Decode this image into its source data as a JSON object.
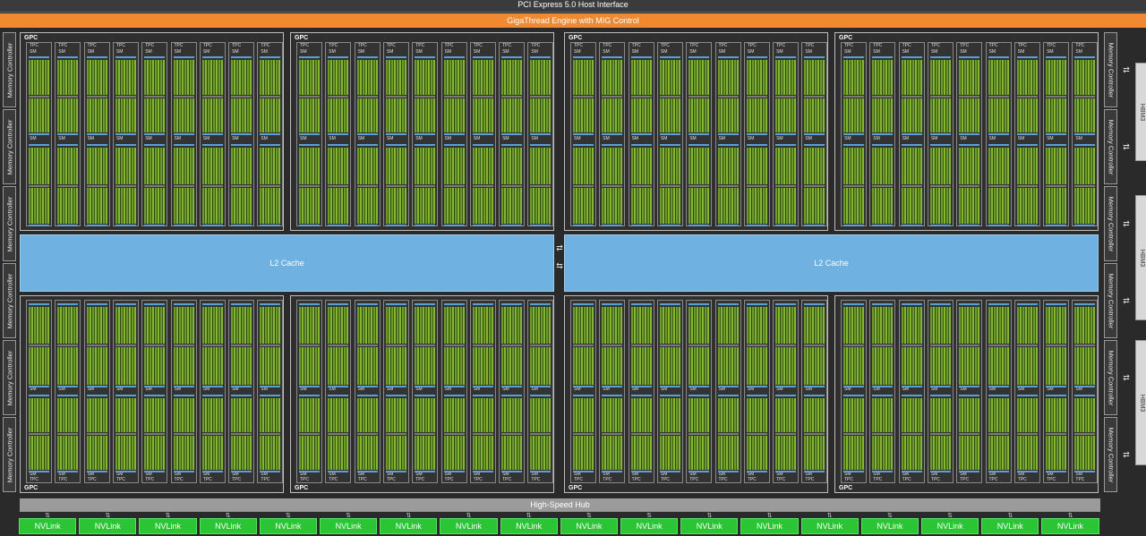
{
  "header": {
    "pcie": "PCI Express 5.0 Host Interface",
    "gigathread": "GigaThread Engine with MIG Control"
  },
  "memory_controller_label": "Memory Controller",
  "hbm_label": "HBM3",
  "gpc_label": "GPC",
  "tpc_label": "TPC",
  "sm_label": "SM",
  "l2": {
    "left": "L2 Cache",
    "right": "L2 Cache"
  },
  "hub": {
    "label": "High-Speed Hub"
  },
  "nvlink_label": "NVLink",
  "colors": {
    "gigathread": "#ef8a32",
    "l2": "#6fb1e0",
    "nvlink": "#2bc435",
    "cores": "#6e9d2e"
  }
}
